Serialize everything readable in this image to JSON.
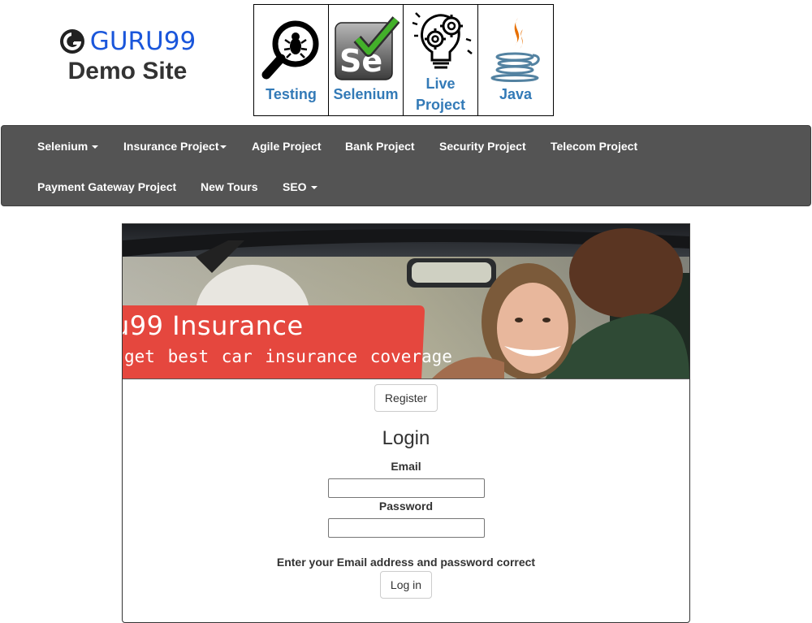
{
  "site": {
    "logo_text": "GURU99",
    "logo_subtitle": "Demo Site",
    "brand_color": "#1a56db"
  },
  "tiles": [
    {
      "label": "Testing",
      "icon": "bug-magnifier-icon"
    },
    {
      "label": "Selenium",
      "icon": "selenium-icon"
    },
    {
      "label": "Live Project",
      "icon": "lightbulb-gears-icon"
    },
    {
      "label": "Java",
      "icon": "java-cup-icon"
    }
  ],
  "navbar": {
    "background": "#545454",
    "items": [
      {
        "label": "Selenium",
        "dropdown": true
      },
      {
        "label": "Insurance Project",
        "dropdown": true
      },
      {
        "label": "Agile Project",
        "dropdown": false
      },
      {
        "label": "Bank Project",
        "dropdown": false
      },
      {
        "label": "Security Project",
        "dropdown": false
      },
      {
        "label": "Telecom Project",
        "dropdown": false
      },
      {
        "label": "Payment Gateway Project",
        "dropdown": false
      },
      {
        "label": "New Tours",
        "dropdown": false
      },
      {
        "label": "SEO",
        "dropdown": true
      }
    ]
  },
  "banner": {
    "title": "u99 Insurance",
    "subtitle": "get best car insurance coverage",
    "accent_color": "#e5473e"
  },
  "login": {
    "register_label": "Register",
    "title": "Login",
    "email_label": "Email",
    "email_value": "",
    "password_label": "Password",
    "password_value": "",
    "hint": "Enter your Email address and password correct",
    "submit_label": "Log in"
  }
}
